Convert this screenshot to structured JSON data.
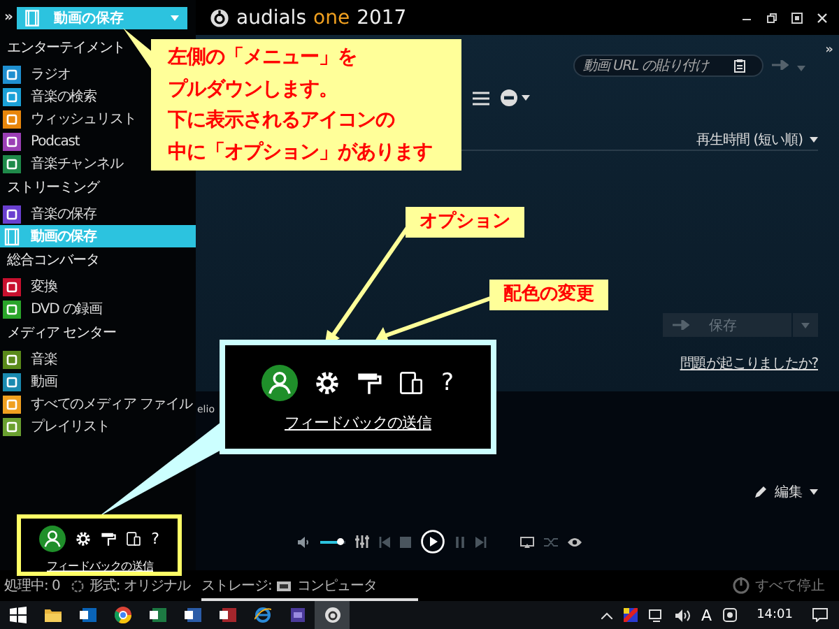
{
  "sidebar": {
    "expand_glyph": "»",
    "view_selector": {
      "label": "動画の保存"
    },
    "sections": [
      {
        "title": "エンターテイメント",
        "items": [
          {
            "label": "ラジオ",
            "color": "#1f8fd0",
            "selected": false
          },
          {
            "label": "音楽の検索",
            "color": "#1ba1d8",
            "selected": false
          },
          {
            "label": "ウィッシュリスト",
            "color": "#e8860c",
            "selected": false
          },
          {
            "label": "Podcast",
            "color": "#9b3fb5",
            "selected": false
          },
          {
            "label": "音楽チャンネル",
            "color": "#1f8a4a",
            "selected": false
          }
        ]
      },
      {
        "title": "ストリーミング",
        "items": [
          {
            "label": "音楽の保存",
            "color": "#6a3fd0",
            "selected": false
          },
          {
            "label": "動画の保存",
            "selected": true
          }
        ]
      },
      {
        "title": "総合コンバータ",
        "items": [
          {
            "label": "変換",
            "color": "#c8102e",
            "selected": false
          },
          {
            "label": "DVD の録画",
            "color": "#2aa52a",
            "selected": false
          }
        ]
      },
      {
        "title": "メディア センター",
        "items": [
          {
            "label": "音楽",
            "color": "#5a8a1a",
            "selected": false
          },
          {
            "label": "動画",
            "color": "#1a8ab0",
            "selected": false
          },
          {
            "label": "すべてのメディア ファイル",
            "color": "#f0a020",
            "selected": false
          },
          {
            "label": "プレイリスト",
            "color": "#6aa030",
            "selected": false
          }
        ]
      }
    ]
  },
  "app_title": {
    "name": "audials",
    "edition": "one",
    "year": "2017"
  },
  "main": {
    "collapse_glyph": "»",
    "url_field": {
      "placeholder": "動画 URL の貼り付け"
    },
    "sort": "再生時間 (短い順)",
    "save_button": {
      "label": "保存",
      "disabled": true
    },
    "help_link": "問題が起こりましたか?",
    "partial_text": "elio",
    "edit_menu": "編集"
  },
  "player": {
    "volume": {
      "level": 0.85
    }
  },
  "options_bar": {
    "help_glyph": "?",
    "feedback_link": "フィードバックの送信"
  },
  "status_bar": {
    "processing": "処理中: 0",
    "format": "形式: オリジナル",
    "storage_label": "ストレージ:",
    "storage_value": "コンピュータ",
    "stop_all": "すべて停止"
  },
  "taskbar": {
    "ime": "A",
    "clock": "14:01"
  },
  "annotations": [
    {
      "kind": "callout",
      "lines": [
        "左側の「メニュー」を",
        "プルダウンします。",
        "下に表示されるアイコンの",
        "中に「オプション」があります"
      ]
    },
    {
      "kind": "label",
      "text": "オプション"
    },
    {
      "kind": "label",
      "text": "配色の変更"
    }
  ],
  "options_zoom": {
    "help_glyph": "?",
    "feedback_link": "フィードバックの送信"
  }
}
